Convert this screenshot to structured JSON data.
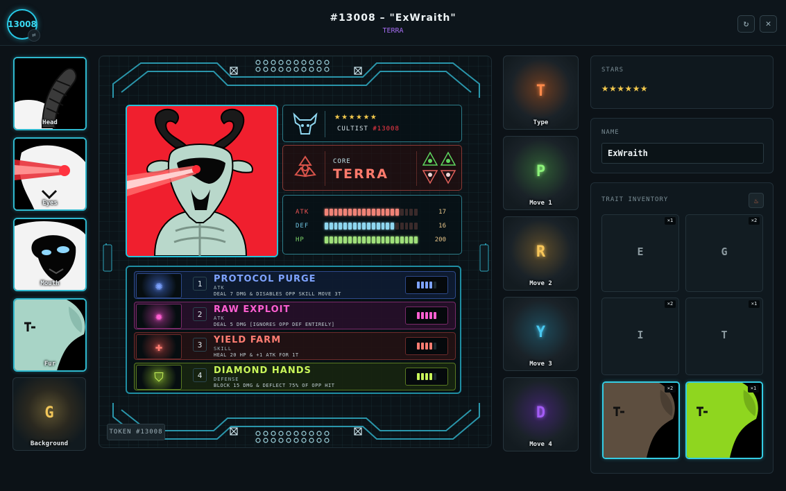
{
  "header": {
    "badge": "13008",
    "badge_sub_icon": "swap-icon",
    "title": "#13008 – \"ExWraith\"",
    "subtitle": "TERRA",
    "refresh_icon": "↻",
    "close_icon": "✕"
  },
  "slots": [
    {
      "label": "Head"
    },
    {
      "label": "Eyes"
    },
    {
      "label": "Mouth"
    },
    {
      "label": "Fur"
    },
    {
      "label": "Background",
      "letter": "G",
      "color": "#f2c75a"
    }
  ],
  "card": {
    "stars": "★★★★★★",
    "class_label": "CULTIST",
    "token_ref": "#13008",
    "core_label": "CORE",
    "core_name": "TERRA",
    "stats": [
      {
        "label": "ATK",
        "value": "17",
        "fill": 0.78,
        "color": "#f08377"
      },
      {
        "label": "DEF",
        "value": "16",
        "fill": 0.73,
        "color": "#8fd7f0"
      },
      {
        "label": "HP",
        "value": "200",
        "fill": 1.0,
        "color": "#9fe07a"
      }
    ],
    "moves": [
      {
        "num": "1",
        "name": "PROTOCOL PURGE",
        "type": "ATK",
        "desc": "DEAL 7 DMG & DISABLES OPP SKILL MOVE 3T",
        "color": "#7ea3ff",
        "border": "#2e4a8c",
        "bg": "rgba(20,35,70,.55)",
        "meter": 4
      },
      {
        "num": "2",
        "name": "RAW EXPLOIT",
        "type": "ATK",
        "desc": "DEAL 5 DMG [IGNORES OPP DEF ENTIRELY]",
        "color": "#ff5fd2",
        "border": "#7a2a6a",
        "bg": "rgba(60,15,55,.55)",
        "meter": 5
      },
      {
        "num": "3",
        "name": "YIELD FARM",
        "type": "SKILL",
        "desc": "HEAL 20 HP & +1 ATK FOR 1T",
        "color": "#ff7d72",
        "border": "#6d2b2b",
        "bg": "rgba(55,18,18,.55)",
        "meter": 4
      },
      {
        "num": "4",
        "name": "DIAMOND HANDS",
        "type": "DEFENSE",
        "desc": "BLOCK 15 DMG & DEFLECT 75% OF OPP HIT",
        "color": "#c9f55a",
        "border": "#5a7a22",
        "bg": "rgba(35,50,12,.55)",
        "meter": 4
      }
    ],
    "token_chip": "TOKEN #13008"
  },
  "moves_column": [
    {
      "letter": "T",
      "label": "Type",
      "color": "#ff8a4a",
      "glow": "#6a3b20"
    },
    {
      "letter": "P",
      "label": "Move 1",
      "color": "#8cf27a",
      "glow": "#2f5a34"
    },
    {
      "letter": "R",
      "label": "Move 2",
      "color": "#f7c65a",
      "glow": "#5a4a2a"
    },
    {
      "letter": "Y",
      "label": "Move 3",
      "color": "#49c8f0",
      "glow": "#1d4a5a"
    },
    {
      "letter": "D",
      "label": "Move 4",
      "color": "#a35cf5",
      "glow": "#3d2467"
    }
  ],
  "stars_panel": {
    "label": "STARS",
    "stars": "★★★★★★"
  },
  "name_panel": {
    "label": "NAME",
    "value": "ExWraith"
  },
  "inventory": {
    "label": "TRAIT INVENTORY",
    "icon": "flame-icon",
    "items": [
      {
        "letter": "E",
        "count": "×1"
      },
      {
        "letter": "G",
        "count": "×2"
      },
      {
        "letter": "I",
        "count": "×2"
      },
      {
        "letter": "T",
        "count": "×1"
      },
      {
        "count": "×2",
        "fur": "#5d4e3f"
      },
      {
        "count": "×1",
        "fur": "#8fd61f"
      }
    ]
  }
}
